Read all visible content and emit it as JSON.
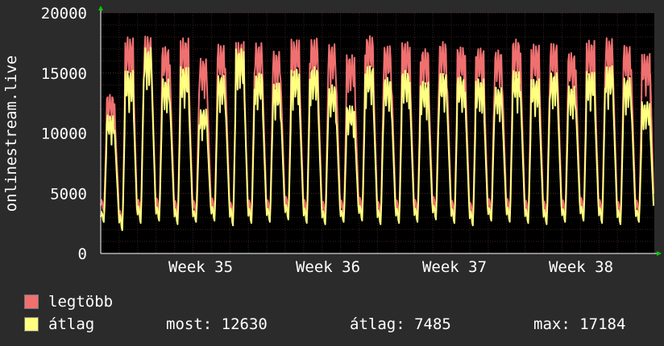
{
  "chart_data": {
    "type": "line",
    "ylabel": "onlinestream.live",
    "ylim": [
      0,
      20000
    ],
    "y_ticks": [
      "0",
      "5000",
      "10000",
      "15000",
      "20000"
    ],
    "x_ticks": [
      "Week 35",
      "Week 36",
      "Week 37",
      "Week 38"
    ],
    "grid": true,
    "colors": {
      "background": "#2b2b2b",
      "plot": "#000000",
      "grid": "#3a2222",
      "max_series": "#f07070",
      "avg_series": "#ffff80",
      "axis": "#ffffff",
      "arrow": "#00cc00"
    },
    "series": [
      {
        "name": "legtöbb",
        "color": "#f07070",
        "peak_levels": [
          13200,
          18000,
          18100,
          17200,
          17900,
          16200,
          17400,
          17600,
          17500,
          16800,
          17800,
          17900,
          17400,
          16500,
          18100,
          17300,
          17600,
          17000,
          17600,
          17200,
          17100,
          16900,
          17800,
          17400,
          17500,
          16700,
          17700,
          17900,
          17300,
          16600
        ],
        "trough_levels": [
          3500,
          2000,
          3000,
          3200,
          2900,
          3100,
          3200,
          2800,
          3000,
          3100,
          3300,
          3000,
          2900,
          3100,
          3200,
          2900,
          3000,
          3100,
          3300,
          3000,
          2800,
          3200,
          3100,
          3000,
          2900,
          3100,
          3200,
          3000,
          2900,
          3100
        ]
      },
      {
        "name": "átlag",
        "color": "#ffff80",
        "peak_levels": [
          11500,
          15200,
          17100,
          14500,
          15500,
          12000,
          14800,
          17000,
          15000,
          14200,
          15300,
          15500,
          14000,
          12300,
          15600,
          14600,
          15200,
          14300,
          15000,
          14700,
          14500,
          13800,
          15200,
          14500,
          15000,
          13900,
          15100,
          15600,
          14600,
          12600
        ],
        "trough_levels": [
          2600,
          1900,
          2500,
          2700,
          2400,
          2600,
          2700,
          2300,
          2500,
          2600,
          2800,
          2500,
          2400,
          2600,
          2700,
          2400,
          2500,
          2600,
          2800,
          2500,
          2300,
          2700,
          2600,
          2500,
          2400,
          2600,
          2700,
          2500,
          2400,
          2600
        ]
      }
    ]
  },
  "legend": {
    "max_label": "legtöbb",
    "avg_label": "átlag",
    "current": "most: 12630",
    "average": "átlag: 7485",
    "maximum": "max: 17184"
  }
}
